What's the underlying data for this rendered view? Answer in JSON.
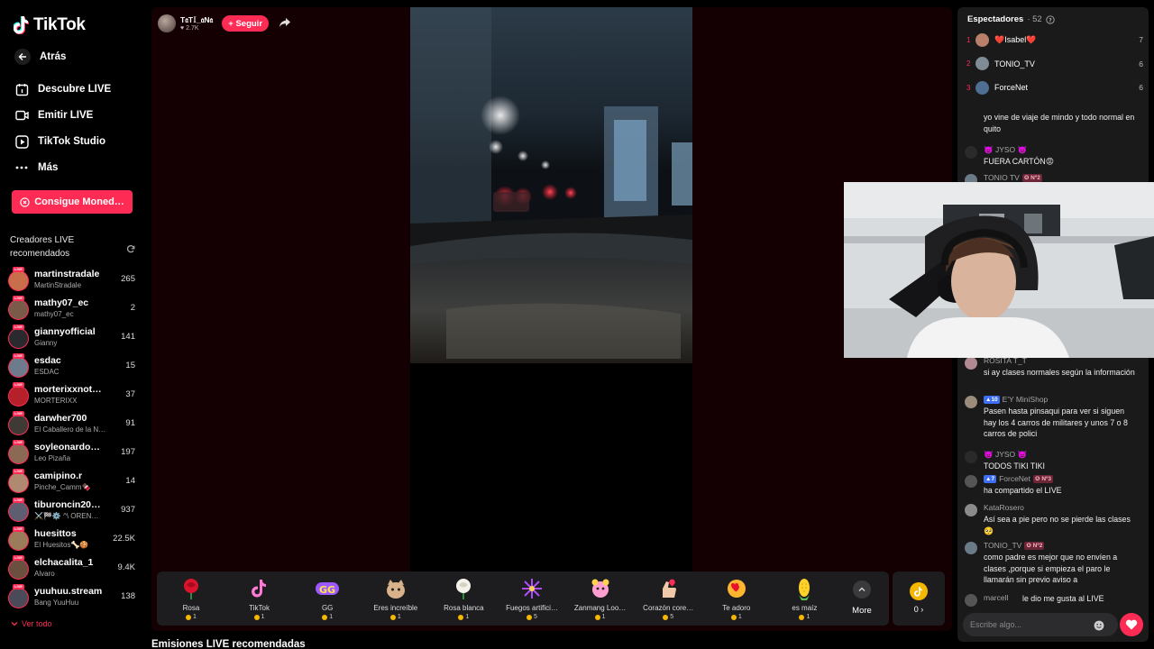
{
  "app": {
    "name": "TikTok"
  },
  "sidebar": {
    "back": "Atrás",
    "nav": [
      {
        "label": "Descubre LIVE",
        "icon": "calendar-live-icon"
      },
      {
        "label": "Emitir LIVE",
        "icon": "camera-icon"
      },
      {
        "label": "TikTok Studio",
        "icon": "studio-icon"
      },
      {
        "label": "Más",
        "icon": "more-dots-icon"
      }
    ],
    "coins_button": "Consigue Moned…",
    "recommended_title": "Creadores LIVE recomendados",
    "see_all": "Ver todo",
    "creators": [
      {
        "name": "martinstradale",
        "sub": "MartinStradale",
        "count": "265"
      },
      {
        "name": "mathy07_ec",
        "sub": "mathy07_ec",
        "count": "2"
      },
      {
        "name": "giannyofficial",
        "sub": "Gianny",
        "count": "141"
      },
      {
        "name": "esdac",
        "sub": "ESDAC",
        "count": "15"
      },
      {
        "name": "morterixxnot…",
        "sub": "MORTERIXX",
        "count": "37"
      },
      {
        "name": "darwher700",
        "sub": "El Caballero de la N…",
        "count": "91"
      },
      {
        "name": "soyleonardo…",
        "sub": "Leo Pizaña",
        "count": "197"
      },
      {
        "name": "camipino.r",
        "sub": "Pinche_Camm🍫",
        "count": "14"
      },
      {
        "name": "tiburoncin20…",
        "sub": "⚔️🏁⚙️ ^\\ OREN…",
        "count": "937"
      },
      {
        "name": "huesittos",
        "sub": "El Huesitos🦴🍪",
        "count": "22.5K"
      },
      {
        "name": "elchacalita_1",
        "sub": "Alvaro",
        "count": "9.4K"
      },
      {
        "name": "yuuhuu.stream",
        "sub": "Bang YuuHuu",
        "count": "138"
      }
    ]
  },
  "stream": {
    "host_name": "T𝔞T𝕀_𝔞N𝔞",
    "host_likes": "2.7K",
    "follow_label": "+ Seguir"
  },
  "gifts": [
    {
      "name": "Rosa",
      "price": "1",
      "icon": "rose-icon"
    },
    {
      "name": "TikTok",
      "price": "1",
      "icon": "tiktok-note-icon"
    },
    {
      "name": "GG",
      "price": "1",
      "icon": "gg-icon"
    },
    {
      "name": "Eres increíble",
      "price": "1",
      "icon": "cat-icon"
    },
    {
      "name": "Rosa blanca",
      "price": "1",
      "icon": "white-rose-icon"
    },
    {
      "name": "Fuegos artifici…",
      "price": "5",
      "icon": "fireworks-icon"
    },
    {
      "name": "Zanmang Loo…",
      "price": "1",
      "icon": "zanmang-icon"
    },
    {
      "name": "Corazón core…",
      "price": "5",
      "icon": "finger-heart-icon"
    },
    {
      "name": "Te adoro",
      "price": "1",
      "icon": "heart-face-icon"
    },
    {
      "name": "es maíz",
      "price": "1",
      "icon": "corn-icon"
    }
  ],
  "more_label": "More",
  "coin_balance": "0",
  "recommended_streams": "Emisiones LIVE recomendadas",
  "chat": {
    "viewers_label": "Espectadores",
    "viewers_count": "· 52",
    "top_viewers": [
      {
        "rank": "1",
        "name": "❤️Isabel❤️",
        "score": "7"
      },
      {
        "rank": "2",
        "name": "TONIO_TV",
        "score": "6"
      },
      {
        "rank": "3",
        "name": "ForceNet",
        "score": "6"
      }
    ],
    "messages": [
      {
        "user": "",
        "text": "yo vine de viaje de mindo y todo normal en quito"
      },
      {
        "user": "👿 JYSO 👿",
        "text": "FUERA CARTÓN😡"
      },
      {
        "user": "TONIO TV",
        "rank_badge": "❻ Nº2",
        "text": ""
      },
      {
        "user": "ROSITA T_T",
        "text": "si ay clases normales según la información"
      },
      {
        "user": "E'Y MiniShop",
        "level": "10",
        "text": "Pasen hasta pinsaqui para ver si siguen hay los 4 carros de militares y unos 7 o 8 carros de polici"
      },
      {
        "user": "👿 JYSO 👿",
        "text": "TODOS TIKI TIKI"
      },
      {
        "user": "ForceNet",
        "level": "7",
        "rank_badge": "❻ Nº3",
        "text": "ha compartido el LIVE"
      },
      {
        "user": "KataRosero",
        "text": "Así sea a pie pero no se pierde las clases 🥺"
      },
      {
        "user": "TONIO_TV",
        "rank_badge": "❻ Nº2",
        "text": "como padre es mejor que no envíen a clases ,porque si empieza el paro le llamarán sin previo aviso a"
      },
      {
        "user": "marcell",
        "text": "le dio me gusta al LIVE"
      }
    ],
    "input_placeholder": "Escribe algo..."
  },
  "colors": {
    "accent": "#fe2c55",
    "coin": "#f5b800",
    "stage_bg": "#140003",
    "chat_bg": "#1a1a1b"
  }
}
